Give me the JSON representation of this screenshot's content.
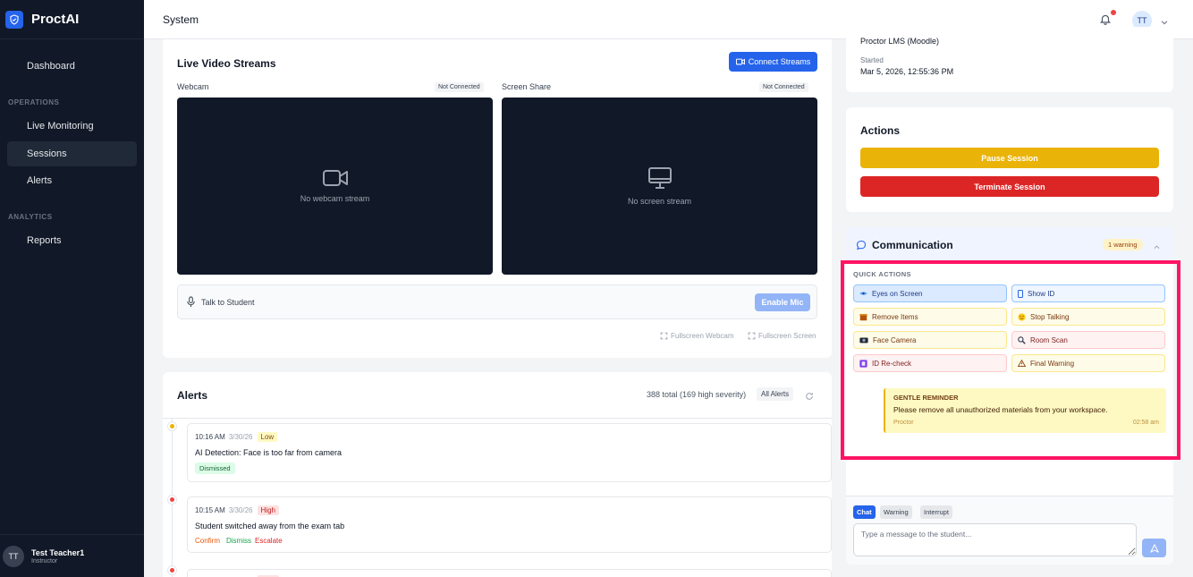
{
  "app": {
    "name": "ProctAI"
  },
  "sidebar": {
    "items": [
      {
        "label": "Dashboard"
      },
      {
        "label": "Live Monitoring"
      },
      {
        "label": "Sessions"
      },
      {
        "label": "Alerts"
      },
      {
        "label": "Reports"
      }
    ],
    "sections": {
      "operations": "OPERATIONS",
      "analytics": "ANALYTICS"
    },
    "active_item": "Sessions",
    "user": {
      "initials": "TT",
      "name": "Test Teacher1",
      "role": "Instructor"
    }
  },
  "topbar": {
    "title": "System",
    "avatar_initials": "TT",
    "has_notification": true
  },
  "video": {
    "title": "Live Video Streams",
    "connect_label": "Connect Streams",
    "webcam": {
      "label": "Webcam",
      "status": "Not Connected",
      "empty_text": "No webcam stream"
    },
    "screen": {
      "label": "Screen Share",
      "status": "Not Connected",
      "empty_text": "No screen stream"
    },
    "talk_label": "Talk to Student",
    "mic_button": "Enable Mic",
    "fullscreen_webcam": "Fullscreen Webcam",
    "fullscreen_screen": "Fullscreen Screen"
  },
  "alerts": {
    "title": "Alerts",
    "summary": "388 total (169 high severity)",
    "filter": "All Alerts",
    "items": [
      {
        "time": "10:16 AM",
        "date": "3/30/26",
        "severity": "Low",
        "title": "AI Detection: Face is too far from camera",
        "status": "Dismissed"
      },
      {
        "time": "10:15 AM",
        "date": "3/30/26",
        "severity": "High",
        "title": "Student switched away from the exam tab",
        "actions": [
          "Confirm",
          "Dismiss",
          "Escalate"
        ]
      }
    ]
  },
  "session_info": {
    "platform": "Proctor LMS (Moodle)",
    "started_label": "Started",
    "started_value": "Mar 5, 2026, 12:55:36 PM"
  },
  "actions": {
    "title": "Actions",
    "pause": "Pause Session",
    "terminate": "Terminate Session"
  },
  "communication": {
    "title": "Communication",
    "badge": "1 warning",
    "quick_actions_label": "QUICK ACTIONS",
    "quick_actions": [
      {
        "label": "Eyes on Screen",
        "icon": "eye-icon"
      },
      {
        "label": "Show ID",
        "icon": "id-card-icon"
      },
      {
        "label": "Remove Items",
        "icon": "box-icon"
      },
      {
        "label": "Stop Talking",
        "icon": "face-icon"
      },
      {
        "label": "Face Camera",
        "icon": "camera-icon"
      },
      {
        "label": "Room Scan",
        "icon": "magnifier-icon"
      },
      {
        "label": "ID Re-check",
        "icon": "id-badge-icon"
      },
      {
        "label": "Final Warning",
        "icon": "warning-icon"
      }
    ],
    "reminder": {
      "title": "GENTLE REMINDER",
      "message": "Please remove all unauthorized materials from your workspace.",
      "sender": "Proctor",
      "time": "02:58 am"
    },
    "modes": [
      "Chat",
      "Warning",
      "Interrupt"
    ],
    "active_mode": "Chat",
    "input_placeholder": "Type a message to the student..."
  },
  "colors": {
    "sidebar_bg": "#111827",
    "accent": "#2563eb",
    "pause": "#eab308",
    "terminate": "#dc2626",
    "highlight": "#ff1464"
  }
}
